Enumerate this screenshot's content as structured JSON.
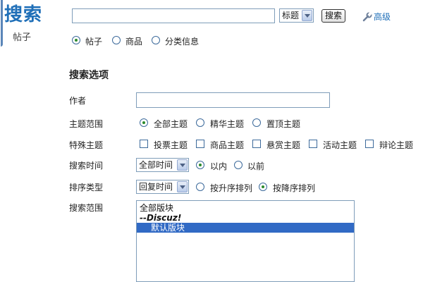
{
  "sidebar": {
    "title": "搜索",
    "item": "帖子"
  },
  "search": {
    "query": "",
    "type_selected": "标题",
    "button": "搜索",
    "advanced": "高级"
  },
  "scope_tabs": [
    {
      "label": "帖子",
      "checked": true
    },
    {
      "label": "商品",
      "checked": false
    },
    {
      "label": "分类信息",
      "checked": false
    }
  ],
  "options": {
    "title": "搜索选项",
    "author_label": "作者",
    "author_value": "",
    "topic_range_label": "主题范围",
    "topic_range": [
      {
        "label": "全部主题",
        "checked": true
      },
      {
        "label": "精华主题",
        "checked": false
      },
      {
        "label": "置顶主题",
        "checked": false
      }
    ],
    "special_label": "特殊主题",
    "special": [
      {
        "label": "投票主题",
        "checked": false
      },
      {
        "label": "商品主题",
        "checked": false
      },
      {
        "label": "悬赏主题",
        "checked": false
      },
      {
        "label": "活动主题",
        "checked": false
      },
      {
        "label": "辩论主题",
        "checked": false
      }
    ],
    "time_label": "搜索时间",
    "time_selected": "全部时间",
    "time_mode": [
      {
        "label": "以内",
        "checked": true
      },
      {
        "label": "以前",
        "checked": false
      }
    ],
    "sort_label": "排序类型",
    "sort_selected": "回复时间",
    "sort_order": [
      {
        "label": "按升序排列",
        "checked": false
      },
      {
        "label": "按降序排列",
        "checked": true
      }
    ],
    "forum_label": "搜索范围",
    "forum_options": [
      {
        "label": "全部版块",
        "kind": "normal"
      },
      {
        "label": "--Discuz!",
        "kind": "group"
      },
      {
        "label": "默认版块",
        "kind": "selected"
      }
    ]
  },
  "colors": {
    "accent": "#1f6fb8",
    "selection": "#316ac5",
    "radio_dot": "#2b8a2b",
    "border": "#7f9db9"
  }
}
